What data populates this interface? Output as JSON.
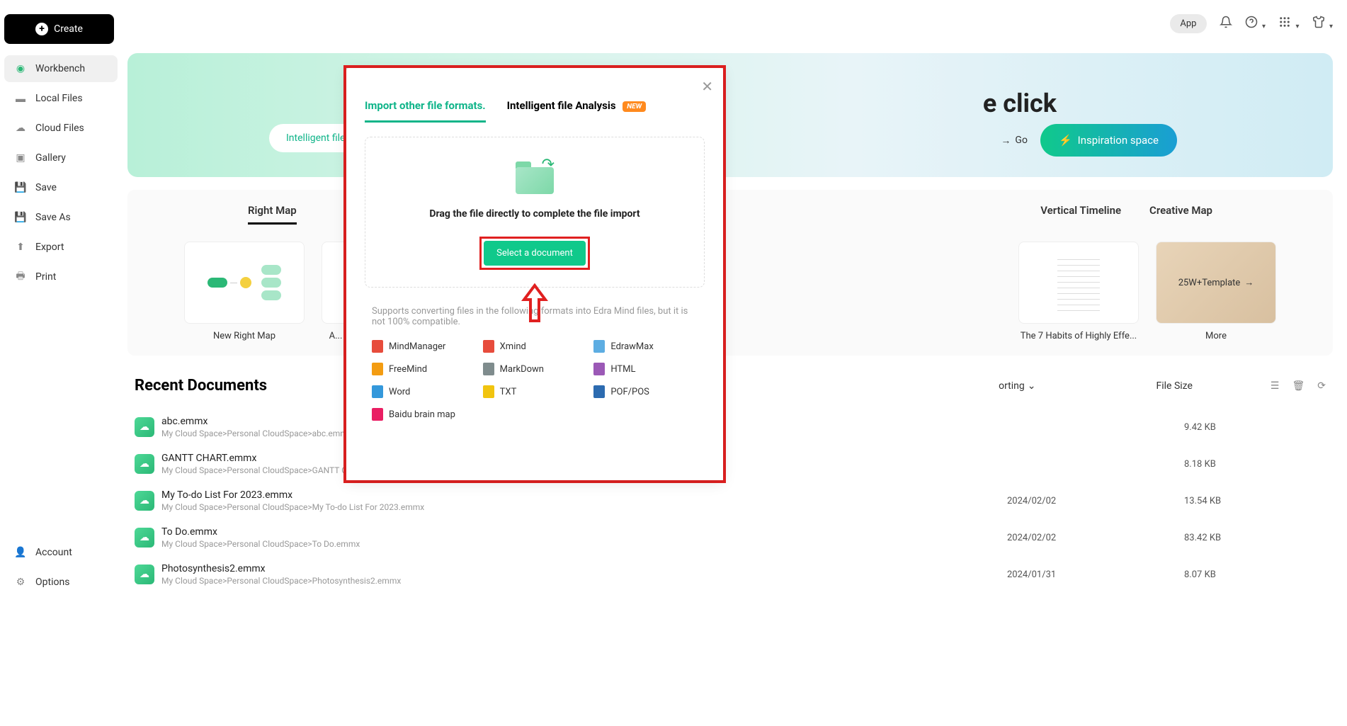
{
  "topbar": {
    "app": "App"
  },
  "sidebar": {
    "create": "Create",
    "items": [
      {
        "label": "Workbench"
      },
      {
        "label": "Local Files"
      },
      {
        "label": "Cloud Files"
      },
      {
        "label": "Gallery"
      },
      {
        "label": "Save"
      },
      {
        "label": "Save As"
      },
      {
        "label": "Export"
      },
      {
        "label": "Print"
      }
    ],
    "bottom": [
      {
        "label": "Account"
      },
      {
        "label": "Options"
      }
    ]
  },
  "hero": {
    "title_fragment": "e click",
    "intelligent_pill": "Intelligent file",
    "go": "Go",
    "inspiration": "Inspiration space"
  },
  "templates": {
    "tabs": [
      "Right Map",
      "Vertical Timeline",
      "Creative Map"
    ],
    "cards": [
      {
        "label": "New Right Map"
      },
      {
        "label": "A..."
      },
      {
        "label": "The 7 Habits of Highly Effe..."
      },
      {
        "label": "More",
        "more_text": "25W+Template"
      }
    ]
  },
  "recent": {
    "title": "Recent Documents",
    "sort_label": "orting",
    "size_label": "File Size",
    "docs": [
      {
        "name": "abc.emmx",
        "path": "My Cloud Space>Personal CloudSpace>abc.emm",
        "date": "",
        "size": "9.42 KB"
      },
      {
        "name": "GANTT CHART.emmx",
        "path": "My Cloud Space>Personal CloudSpace>GANTT C",
        "date": "",
        "size": "8.18 KB"
      },
      {
        "name": "My To-do List For 2023.emmx",
        "path": "My Cloud Space>Personal CloudSpace>My To-do List For 2023.emmx",
        "date": "2024/02/02",
        "size": "13.54 KB"
      },
      {
        "name": "To Do.emmx",
        "path": "My Cloud Space>Personal CloudSpace>To Do.emmx",
        "date": "2024/02/02",
        "size": "83.42 KB"
      },
      {
        "name": "Photosynthesis2.emmx",
        "path": "My Cloud Space>Personal CloudSpace>Photosynthesis2.emmx",
        "date": "2024/01/31",
        "size": "8.07 KB"
      }
    ]
  },
  "modal": {
    "tab1": "Import other file formats.",
    "tab2": "Intelligent file Analysis",
    "new_badge": "NEW",
    "drop_text": "Drag the file directly to complete the file import",
    "select_btn": "Select a document",
    "support_text": "Supports converting files in the following formats into Edra Mind files, but it is not 100% compatible.",
    "formats": [
      {
        "name": "MindManager",
        "color": "fmt-red"
      },
      {
        "name": "Xmind",
        "color": "fmt-red"
      },
      {
        "name": "EdrawMax",
        "color": "fmt-lblue"
      },
      {
        "name": "FreeMind",
        "color": "fmt-orange"
      },
      {
        "name": "MarkDown",
        "color": "fmt-gray"
      },
      {
        "name": "HTML",
        "color": "fmt-purple"
      },
      {
        "name": "Word",
        "color": "fmt-blue"
      },
      {
        "name": "TXT",
        "color": "fmt-yellow"
      },
      {
        "name": "POF/POS",
        "color": "fmt-dblue"
      },
      {
        "name": "Baidu brain map",
        "color": "fmt-pink"
      }
    ]
  }
}
